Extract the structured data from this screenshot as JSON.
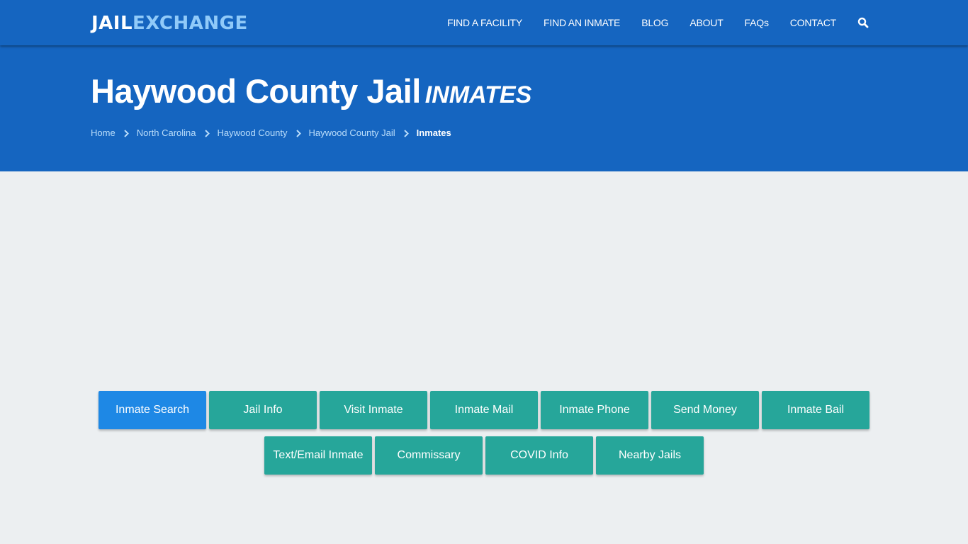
{
  "header": {
    "logo_part1": "JAIL",
    "logo_part2": "EXCHANGE",
    "nav": [
      {
        "label": "FIND A FACILITY"
      },
      {
        "label": "FIND AN INMATE"
      },
      {
        "label": "BLOG"
      },
      {
        "label": "ABOUT"
      },
      {
        "label": "FAQs"
      },
      {
        "label": "CONTACT"
      }
    ],
    "search_icon": "search-icon"
  },
  "hero": {
    "title": "Haywood County Jail",
    "subtitle": "INMATES",
    "breadcrumb": [
      {
        "label": "Home"
      },
      {
        "label": "North Carolina"
      },
      {
        "label": "Haywood County"
      },
      {
        "label": "Haywood County Jail"
      }
    ],
    "breadcrumb_current": "Inmates"
  },
  "colors": {
    "brand_blue": "#1565c0",
    "logo_accent": "#90caf9",
    "active_button": "#1e88e5",
    "button": "#26a69a",
    "page_bg": "#eceff1"
  },
  "buttons": [
    {
      "label": "Inmate Search",
      "active": true
    },
    {
      "label": "Jail Info"
    },
    {
      "label": "Visit Inmate"
    },
    {
      "label": "Inmate Mail"
    },
    {
      "label": "Inmate Phone"
    },
    {
      "label": "Send Money"
    },
    {
      "label": "Inmate Bail"
    },
    {
      "label": "Text/Email Inmate"
    },
    {
      "label": "Commissary"
    },
    {
      "label": "COVID Info"
    },
    {
      "label": "Nearby Jails"
    }
  ]
}
